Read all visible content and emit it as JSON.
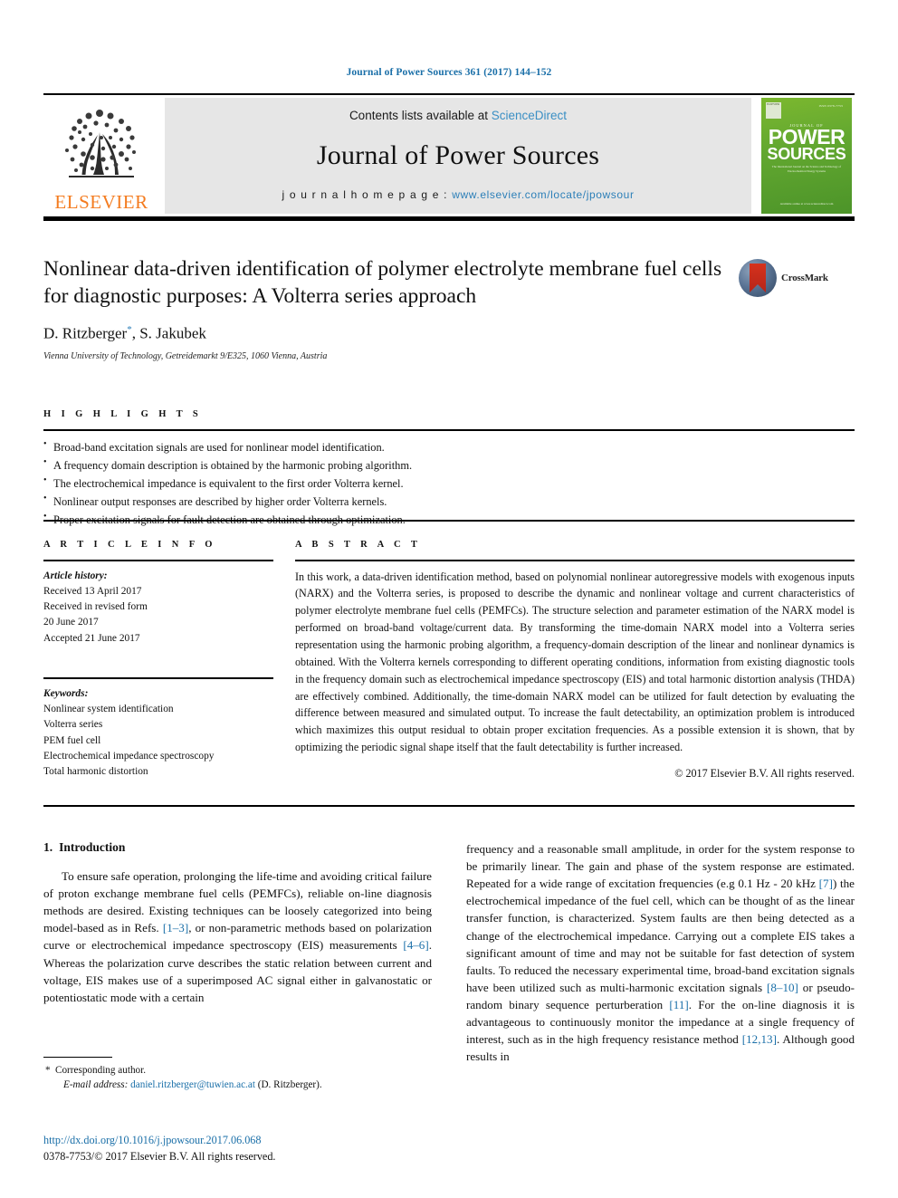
{
  "running_head": "Journal of Power Sources 361 (2017) 144–152",
  "masthead": {
    "publisher_logo_text": "ELSEVIER",
    "contents_prefix": "Contents lists available at ",
    "contents_link": "ScienceDirect",
    "journal_title": "Journal of Power Sources",
    "homepage_label": "j o u r n a l   h o m e p a g e :  ",
    "homepage_url": "www.elsevier.com/locate/jpowsour",
    "cover": {
      "top_left_badge": "ELSEVIER",
      "top_right_code": "ISSN 0378-7753",
      "kicker": "JOURNAL OF",
      "title_line1": "POWER",
      "title_line2": "SOURCES",
      "blurb": "The International Journal on the Science and Technology of Electrochemical Energy Systems",
      "bottom": "Available online at\nwww.sciencedirect.com"
    }
  },
  "article": {
    "title": "Nonlinear data-driven identification of polymer electrolyte membrane fuel cells for diagnostic purposes: A Volterra series approach",
    "authors": "D. Ritzberger",
    "author_marker": "*",
    "authors_rest": ", S. Jakubek",
    "affiliation": "Vienna University of Technology, Getreidemarkt 9/E325, 1060 Vienna, Austria",
    "crossmark_label": "CrossMark"
  },
  "highlights": {
    "kicker": "H I G H L I G H T S",
    "items": [
      "Broad-band excitation signals are used for nonlinear model identification.",
      "A frequency domain description is obtained by the harmonic probing algorithm.",
      "The electrochemical impedance is equivalent to the first order Volterra kernel.",
      "Nonlinear output responses are described by higher order Volterra kernels.",
      "Proper excitation signals for fault detection are obtained through optimization."
    ]
  },
  "article_info": {
    "kicker": "A R T I C L E   I N F O",
    "history_label": "Article history:",
    "history_lines": [
      "Received 13 April 2017",
      "Received in revised form",
      "20 June 2017",
      "Accepted 21 June 2017"
    ],
    "keywords_label": "Keywords:",
    "keywords": [
      "Nonlinear system identification",
      "Volterra series",
      "PEM fuel cell",
      "Electrochemical impedance spectroscopy",
      "Total harmonic distortion"
    ]
  },
  "abstract": {
    "kicker": "A B S T R A C T",
    "text": "In this work, a data-driven identification method, based on polynomial nonlinear autoregressive models with exogenous inputs (NARX) and the Volterra series, is proposed to describe the dynamic and nonlinear voltage and current characteristics of polymer electrolyte membrane fuel cells (PEMFCs). The structure selection and parameter estimation of the NARX model is performed on broad-band voltage/current data. By transforming the time-domain NARX model into a Volterra series representation using the harmonic probing algorithm, a frequency-domain description of the linear and nonlinear dynamics is obtained. With the Volterra kernels corresponding to different operating conditions, information from existing diagnostic tools in the frequency domain such as electrochemical impedance spectroscopy (EIS) and total harmonic distortion analysis (THDA) are effectively combined. Additionally, the time-domain NARX model can be utilized for fault detection by evaluating the difference between measured and simulated output. To increase the fault detectability, an optimization problem is introduced which maximizes this output residual to obtain proper excitation frequencies. As a possible extension it is shown, that by optimizing the periodic signal shape itself that the fault detectability is further increased.",
    "copyright": "© 2017 Elsevier B.V. All rights reserved."
  },
  "introduction": {
    "number": "1.",
    "heading": "Introduction",
    "left_paragraph_part1": "To ensure safe operation, prolonging the life-time and avoiding critical failure of proton exchange membrane fuel cells (PEMFCs), reliable on-line diagnosis methods are desired. Existing techniques can be loosely categorized into being model-based as in Refs. ",
    "ref_1_3": "[1–3]",
    "left_paragraph_part2": ", or non-parametric methods based on polarization curve or electrochemical impedance spectroscopy (EIS) measurements ",
    "ref_4_6": "[4–6]",
    "left_paragraph_part3": ". Whereas the polarization curve describes the static relation between current and voltage, EIS makes use of a superimposed AC signal either in galvanostatic or potentiostatic mode with a certain",
    "right_paragraph_part1": "frequency and a reasonable small amplitude, in order for the system response to be primarily linear. The gain and phase of the system response are estimated. Repeated for a wide range of excitation frequencies (e.g 0.1 Hz - 20 kHz ",
    "ref_7": "[7]",
    "right_paragraph_part2": ") the electrochemical impedance of the fuel cell, which can be thought of as the linear transfer function, is characterized. System faults are then being detected as a change of the electrochemical impedance. Carrying out a complete EIS takes a significant amount of time and may not be suitable for fast detection of system faults. To reduced the necessary experimental time, broad-band excitation signals have been utilized such as multi-harmonic excitation signals ",
    "ref_8_10": "[8–10]",
    "right_paragraph_part3": " or pseudo-random binary sequence perturberation ",
    "ref_11": "[11]",
    "right_paragraph_part4": ". For the on-line diagnosis it is advantageous to continuously monitor the impedance at a single frequency of interest, such as in the high frequency resistance method ",
    "ref_12_13": "[12,13]",
    "right_paragraph_part5": ". Although good results in"
  },
  "footnote": {
    "star": "*",
    "corresponding": "Corresponding author.",
    "email_label": "E-mail address:",
    "email": "daniel.ritzberger@tuwien.ac.at",
    "email_owner": "(D. Ritzberger)."
  },
  "footer": {
    "doi": "http://dx.doi.org/10.1016/j.jpowsour.2017.06.068",
    "issn_copyright": "0378-7753/© 2017 Elsevier B.V. All rights reserved."
  },
  "colors": {
    "link_blue": "#1a6fa8",
    "sciencedirect_blue": "#3a8fc4",
    "elsevier_orange": "#F47C20",
    "cover_green": "#63a830"
  }
}
